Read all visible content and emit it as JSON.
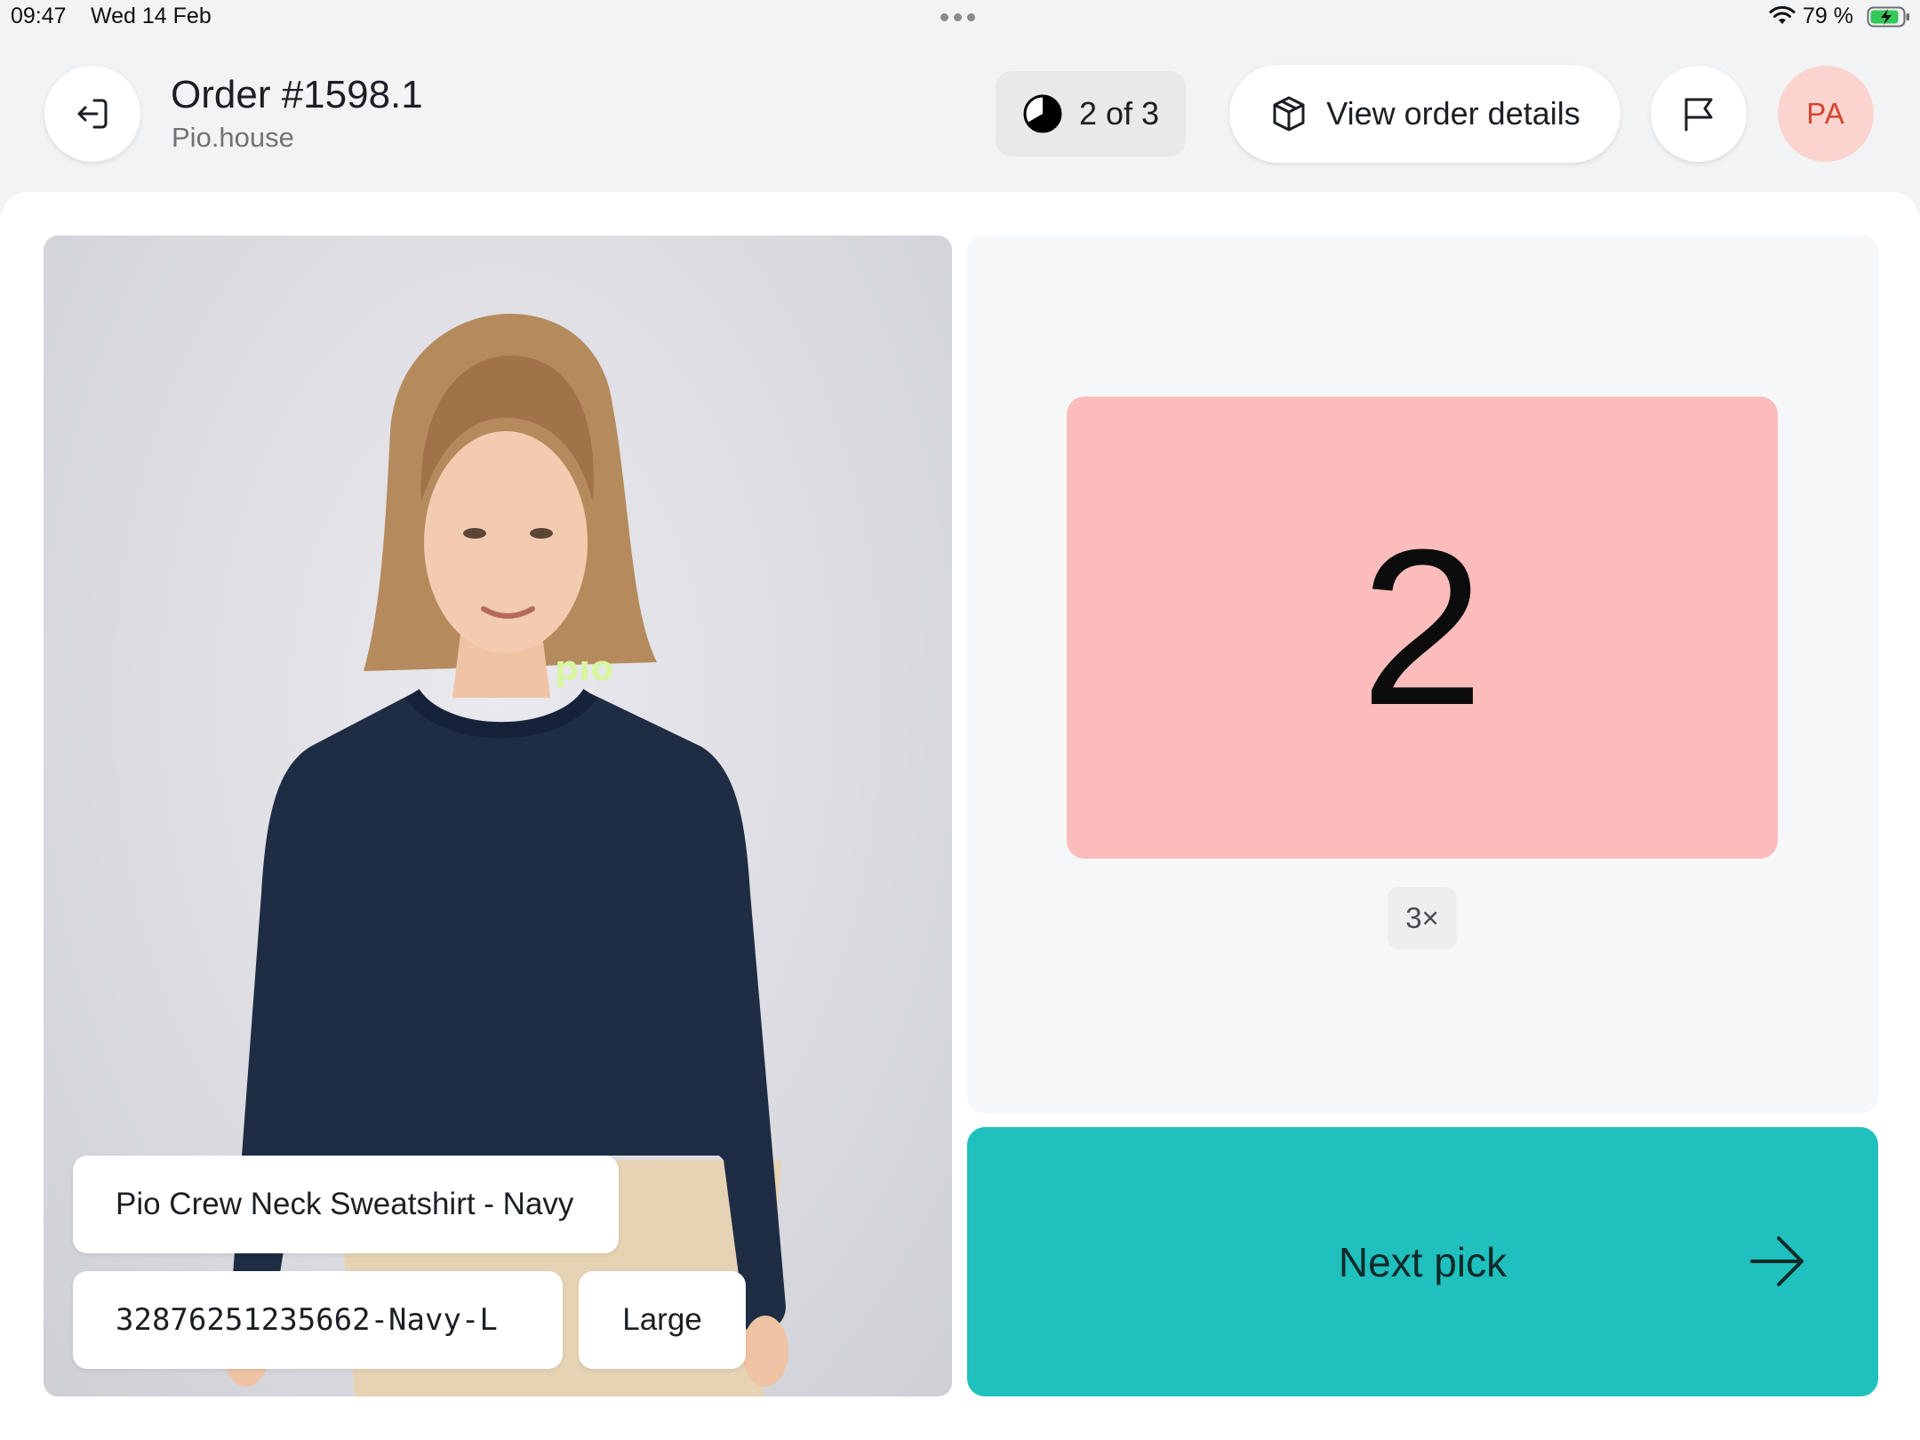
{
  "status_bar": {
    "time": "09:47",
    "date": "Wed 14 Feb",
    "battery": "79 %"
  },
  "header": {
    "order_title": "Order #1598.1",
    "store": "Pio.house",
    "progress": {
      "label": "2 of 3",
      "current": 2,
      "total": 3
    },
    "view_details_label": "View order details",
    "avatar_initials": "PA"
  },
  "product": {
    "name": "Pio Crew Neck Sweatshirt - Navy",
    "sku": "32876251235662-Navy-L",
    "size": "Large",
    "logo_text": "pıo"
  },
  "pick": {
    "bin_number": "2",
    "quantity": "3×"
  },
  "actions": {
    "next_label": "Next pick"
  },
  "colors": {
    "bin": "#fbbcbc",
    "next_button": "#1fc0bd",
    "avatar_bg": "#fbd3cf",
    "avatar_text": "#d4462f",
    "sweatshirt": "#1e2c44"
  }
}
